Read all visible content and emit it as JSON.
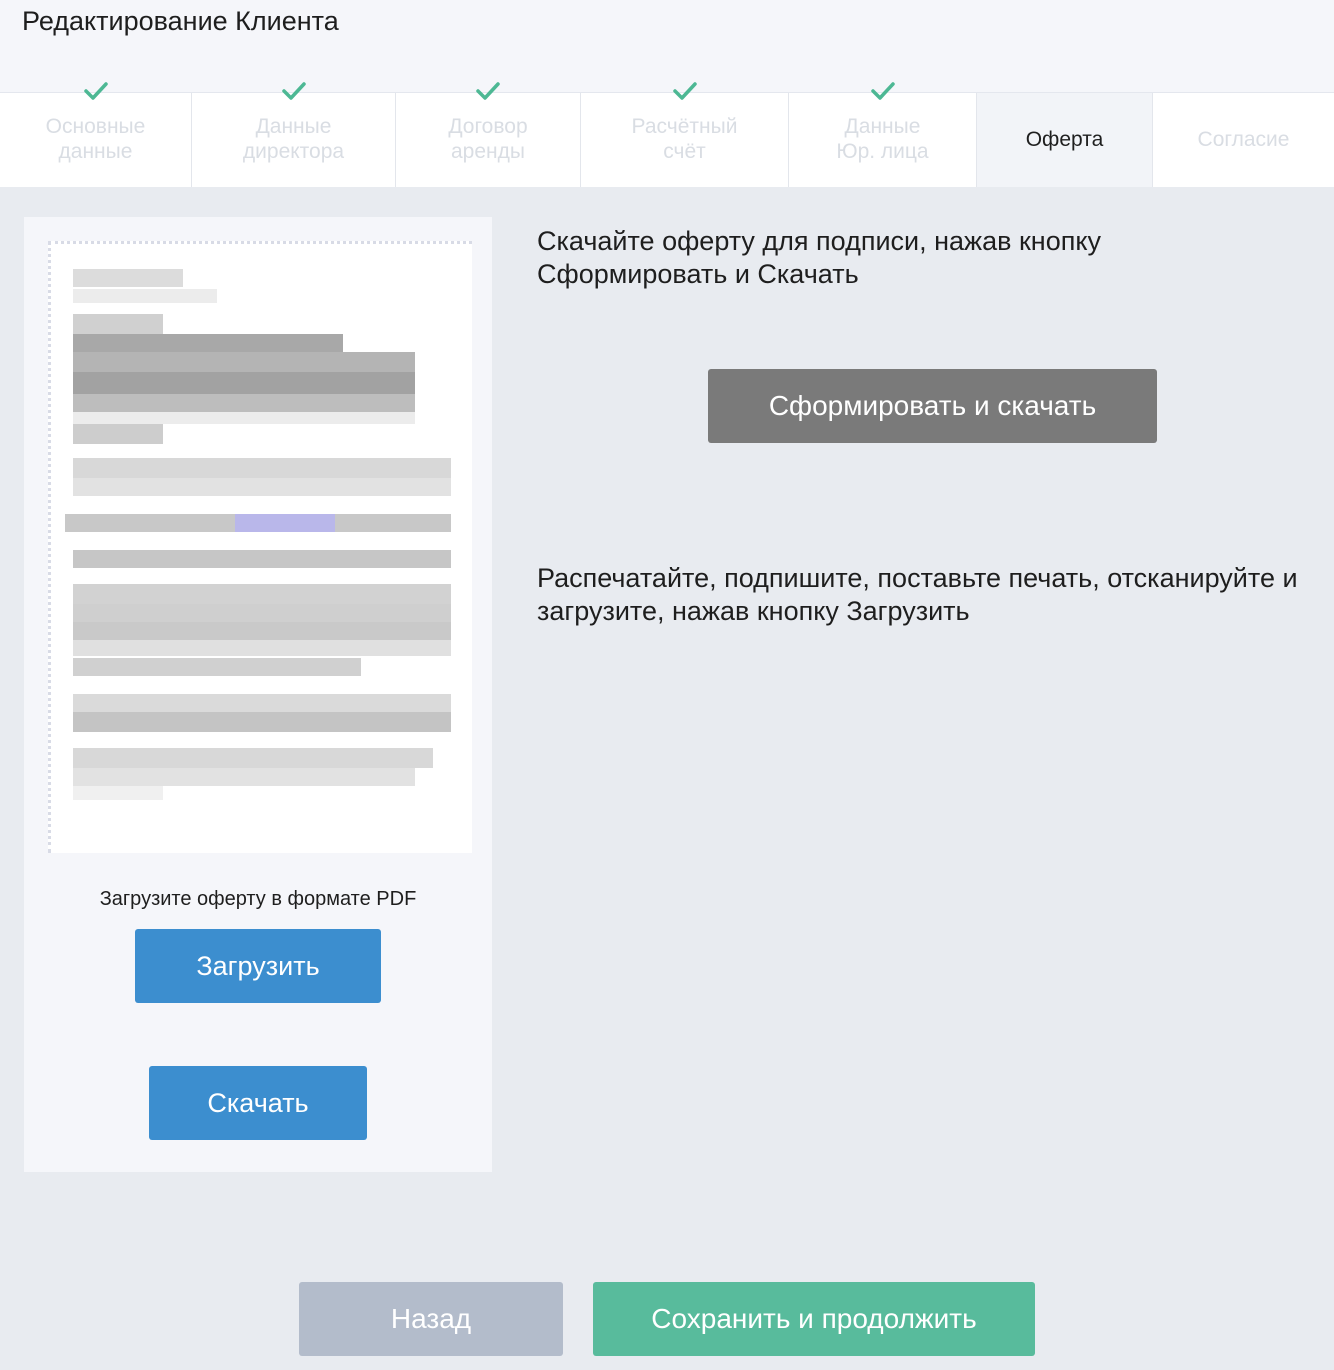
{
  "header": {
    "title": "Редактирование Клиента"
  },
  "steps": [
    {
      "label": "Основные\nданные",
      "completed": true,
      "active": false
    },
    {
      "label": "Данные\nдиректора",
      "completed": true,
      "active": false
    },
    {
      "label": "Договор\nаренды",
      "completed": true,
      "active": false
    },
    {
      "label": "Расчётный\nсчёт",
      "completed": true,
      "active": false
    },
    {
      "label": "Данные\nЮр. лица",
      "completed": true,
      "active": false
    },
    {
      "label": "Оферта",
      "completed": false,
      "active": true
    },
    {
      "label": "Согласие",
      "completed": false,
      "active": false
    }
  ],
  "left_panel": {
    "upload_hint": "Загрузите оферту в формате PDF",
    "upload_button": "Загрузить",
    "download_button": "Скачать"
  },
  "instructions": {
    "download_text": "Скачайте оферту для подписи, нажав кнопку Сформировать и Скачать",
    "generate_button": "Сформировать и скачать",
    "upload_text": "Распечатайте, подпишите, поставьте печать, отсканируйте и загрузите, нажав кнопку Загрузить"
  },
  "footer": {
    "back_button": "Назад",
    "save_button": "Сохранить и продолжить"
  },
  "colors": {
    "check": "#4db894",
    "primary_button": "#3c8ecf",
    "generate_button": "#7a7a7a",
    "back_button": "#b3bccb",
    "save_button": "#58bb9c"
  }
}
